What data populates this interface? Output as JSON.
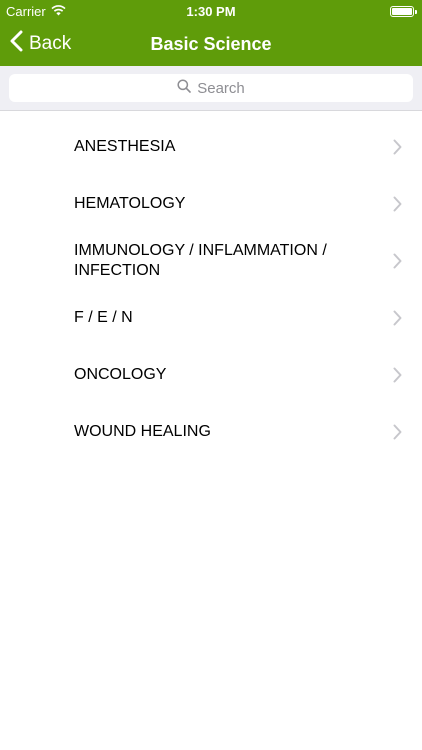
{
  "status_bar": {
    "carrier": "Carrier",
    "time": "1:30 PM",
    "wifi_icon": "wifi-icon",
    "battery_icon": "battery-icon"
  },
  "nav": {
    "back_label": "Back",
    "back_icon": "chevron-left-icon",
    "title": "Basic Science",
    "bar_color": "#5f9c0a"
  },
  "search": {
    "placeholder": "Search",
    "icon": "search-icon"
  },
  "list": {
    "items": [
      {
        "label": "ANESTHESIA"
      },
      {
        "label": "HEMATOLOGY"
      },
      {
        "label": "IMMUNOLOGY / INFLAMMATION / INFECTION"
      },
      {
        "label": "F / E / N"
      },
      {
        "label": "ONCOLOGY"
      },
      {
        "label": "WOUND HEALING"
      }
    ],
    "chevron_icon": "chevron-right-icon"
  }
}
